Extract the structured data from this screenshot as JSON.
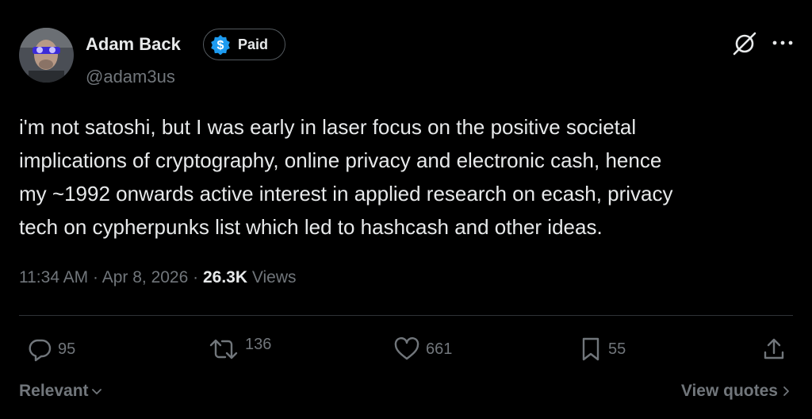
{
  "author": {
    "display_name": "Adam Back",
    "handle": "@adam3us",
    "badge_label": "Paid",
    "badge_icon": "dollar-icon",
    "badge_color": "#1d9bf0"
  },
  "tweet": {
    "lines": [
      "i'm not satoshi, but I was early in laser focus on the positive societal",
      "implications of cryptography, online privacy and electronic cash, hence",
      "my ~1992 onwards active interest in applied research on ecash, privacy",
      "tech on cypherpunks list which led to hashcash and other ideas."
    ]
  },
  "meta": {
    "time": "11:34 AM",
    "separator": "·",
    "date": "Apr 8, 2026",
    "views_count": "26.3K",
    "views_label": "Views"
  },
  "actions": {
    "replies": "95",
    "reposts": "136",
    "likes": "661",
    "bookmarks": "55"
  },
  "footer": {
    "sort_label": "Relevant",
    "view_quotes_label": "View quotes"
  },
  "colors": {
    "background": "#000000",
    "primary_text": "#e7e9ea",
    "secondary_text": "#71767b",
    "divider": "#2f3336"
  }
}
